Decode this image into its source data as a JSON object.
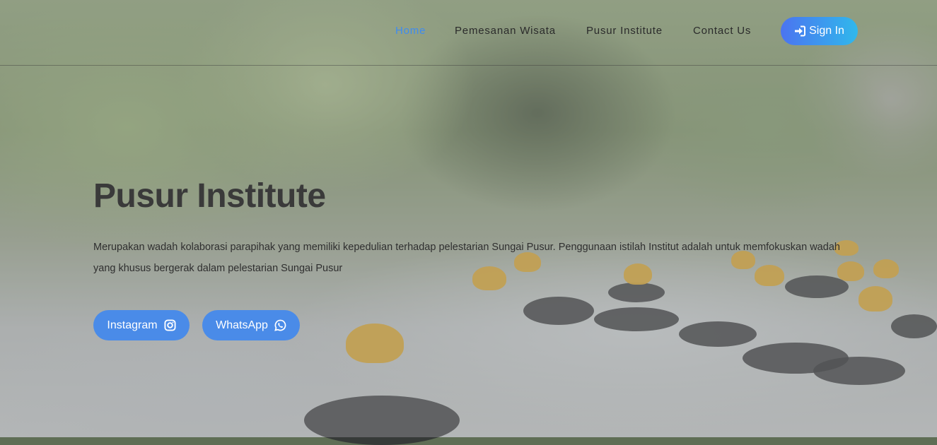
{
  "nav": {
    "items": [
      {
        "label": "Home",
        "active": true
      },
      {
        "label": "Pemesanan Wisata",
        "active": false
      },
      {
        "label": "Pusur Institute",
        "active": false
      },
      {
        "label": "Contact Us",
        "active": false
      }
    ],
    "signin_label": "Sign In",
    "signin_icon": "sign-in-icon"
  },
  "hero": {
    "title": "Pusur Institute",
    "description": "Merupakan wadah kolaborasi parapihak yang memiliki kepedulian terhadap pelestarian Sungai Pusur. Penggunaan istilah Institut adalah untuk memfokuskan wadah yang khusus bergerak dalam pelestarian Sungai Pusur",
    "buttons": [
      {
        "label": "Instagram",
        "icon": "instagram-icon"
      },
      {
        "label": "WhatsApp",
        "icon": "whatsapp-icon"
      }
    ]
  },
  "colors": {
    "active_link": "#3d8bf2",
    "signin_gradient_start": "#4b74f0",
    "signin_gradient_end": "#30b8ec",
    "social_button": "#4a8be8"
  }
}
